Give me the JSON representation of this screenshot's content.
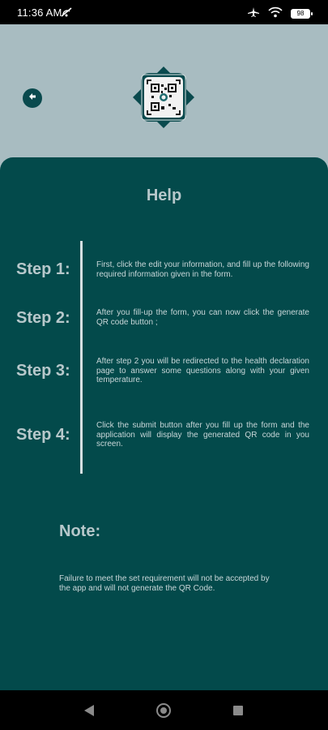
{
  "status_bar": {
    "time": "11:36 AM",
    "battery": "98",
    "icons": [
      "airplane-mode-icon",
      "wifi-icon",
      "battery-icon",
      "no-signal-icon"
    ]
  },
  "header": {
    "back_icon": "arrow-left-icon",
    "logo_icon": "qr-code-logo-icon"
  },
  "help": {
    "title": "Help",
    "steps": [
      {
        "label": "Step 1:",
        "text": "First, click the edit your information, and fill up the following required information given in the form."
      },
      {
        "label": "Step 2:",
        "text": "After you fill-up the form, you can now click the generate QR code button ;"
      },
      {
        "label": "Step 3:",
        "text": "After step 2 you will be redirected to the health declaration page to answer some questions along with your given temperature."
      },
      {
        "label": "Step 4:",
        "text": "Click the submit button after you fill up the form and the application will display the generated QR code in you screen."
      }
    ],
    "note_title": "Note:",
    "note_text": "Failure to meet the set requirement will not be accepted by the app and will not generate the QR Code."
  },
  "colors": {
    "background": "#a8bcc1",
    "card": "#034a4b",
    "accent": "#0a4a4e",
    "text_light": "#b7c8cb"
  },
  "nav_bar": {
    "icons": [
      "nav-back-icon",
      "nav-home-icon",
      "nav-recent-icon"
    ]
  }
}
